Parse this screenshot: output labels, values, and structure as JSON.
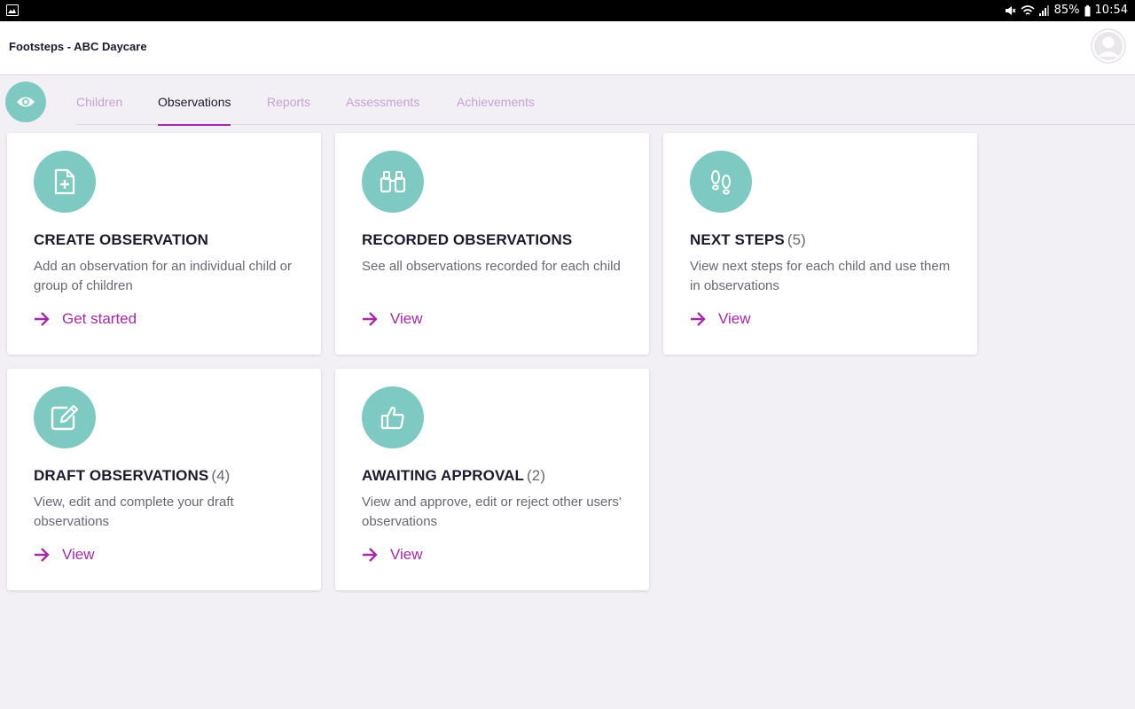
{
  "status_bar": {
    "battery": "85%",
    "time": "10:54"
  },
  "app": {
    "title": "Footsteps - ABC Daycare"
  },
  "colors": {
    "accent": "#a52aa8",
    "icon_circle": "#7ecac2",
    "background": "#f2f0f4"
  },
  "tabs": [
    {
      "label": "Children",
      "active": false
    },
    {
      "label": "Observations",
      "active": true
    },
    {
      "label": "Reports",
      "active": false
    },
    {
      "label": "Assessments",
      "active": false
    },
    {
      "label": "Achievements",
      "active": false
    }
  ],
  "cards": [
    {
      "icon": "add-document-icon",
      "title": "CREATE OBSERVATION",
      "count": "",
      "description": "Add an observation for an individual child or group of children",
      "action": "Get started"
    },
    {
      "icon": "binoculars-icon",
      "title": "RECORDED OBSERVATIONS",
      "count": "",
      "description": "See all observations recorded for each child",
      "action": "View"
    },
    {
      "icon": "footprints-icon",
      "title": "NEXT STEPS",
      "count": "(5)",
      "description": "View next steps for each child and use them in observations",
      "action": "View"
    },
    {
      "icon": "edit-icon",
      "title": "DRAFT OBSERVATIONS",
      "count": "(4)",
      "description": "View, edit and complete your draft observations",
      "action": "View"
    },
    {
      "icon": "thumbs-up-icon",
      "title": "AWAITING APPROVAL",
      "count": "(2)",
      "description": "View and approve, edit or reject other users' observations",
      "action": "View"
    }
  ]
}
